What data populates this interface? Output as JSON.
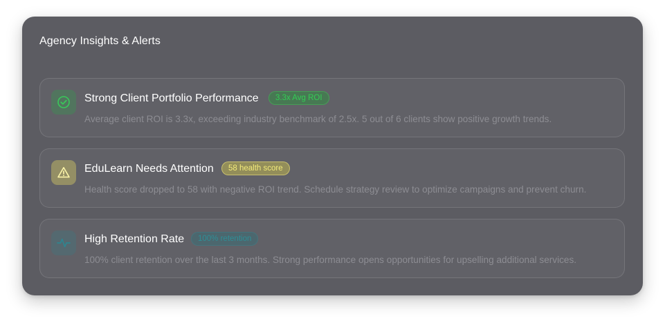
{
  "panel": {
    "title": "Agency Insights & Alerts"
  },
  "alerts": [
    {
      "title": "Strong Client Portfolio Performance",
      "badge": "3.3x Avg ROI",
      "description": "Average client ROI is 3.3x, exceeding industry benchmark of 2.5x. 5 out of 6 clients show positive growth trends.",
      "icon": "check-circle-icon",
      "status": "success",
      "color": "#33cc55"
    },
    {
      "title": "EduLearn Needs Attention",
      "badge": "58 health score",
      "description": "Health score dropped to 58 with negative ROI trend. Schedule strategy review to optimize campaigns and prevent churn.",
      "icon": "warning-triangle-icon",
      "status": "warning",
      "color": "#f3eb7a"
    },
    {
      "title": "High Retention Rate",
      "badge": "100% retention",
      "description": "100% client retention over the last 3 months. Strong performance opens opportunities for upselling additional services.",
      "icon": "activity-pulse-icon",
      "status": "info",
      "color": "#2f8e96"
    }
  ]
}
